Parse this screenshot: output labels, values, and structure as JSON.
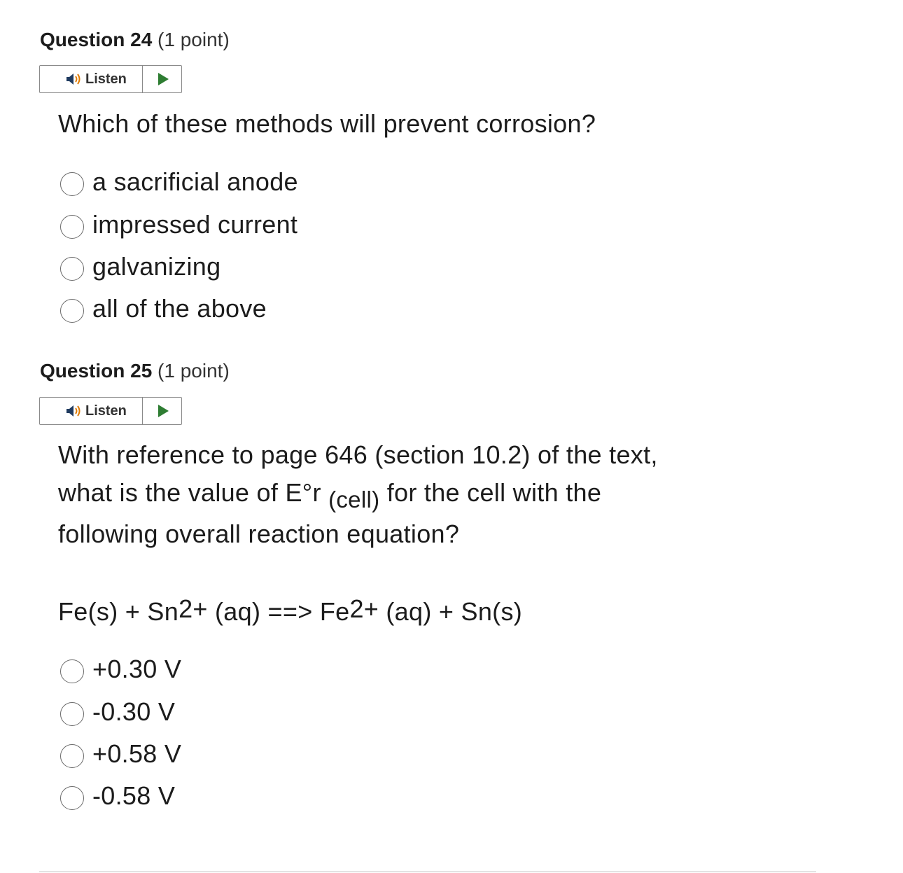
{
  "questions": [
    {
      "name": "Question 24",
      "points": "(1 point)",
      "listen_label": "Listen",
      "prompt": "Which of these methods will prevent corrosion?",
      "options": [
        "a sacrificial anode",
        "impressed current",
        "galvanizing",
        "all of the above"
      ]
    },
    {
      "name": "Question 25",
      "points": "(1 point)",
      "listen_label": "Listen",
      "prompt_line1": "With reference to page 646 (section 10.2) of the text,",
      "prompt_line2_a": "what is the value of E°r ",
      "prompt_line2_sub": "(cell)",
      "prompt_line2_b": " for the cell with the",
      "prompt_line3": "following overall reaction equation?",
      "equation": {
        "part1": "Fe(s) + Sn",
        "sup1": "2+",
        "part2": " (aq) ==> Fe",
        "sup2": "2+",
        "part3": " (aq) + Sn(s)"
      },
      "options": [
        "+0.30 V",
        "-0.30 V",
        "+0.58 V",
        "-0.58 V"
      ]
    }
  ],
  "colors": {
    "play_icon": "#2e7d32",
    "speaker_body": "#1f3a5f",
    "speaker_waves": "#e07b00"
  }
}
